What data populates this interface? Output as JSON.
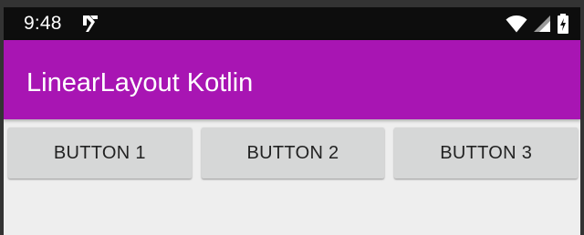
{
  "status_bar": {
    "time": "9:48",
    "icons": [
      "app-notification-icon",
      "wifi-icon",
      "cellular-signal-icon",
      "battery-charging-icon"
    ]
  },
  "app_bar": {
    "title": "LinearLayout Kotlin",
    "color": "#a815b3"
  },
  "buttons": [
    {
      "label": "BUTTON 1"
    },
    {
      "label": "BUTTON 2"
    },
    {
      "label": "BUTTON 3"
    }
  ],
  "colors": {
    "status_bar_bg": "#0d0d0d",
    "background": "#eeeeee",
    "button_bg": "#d6d7d7"
  }
}
